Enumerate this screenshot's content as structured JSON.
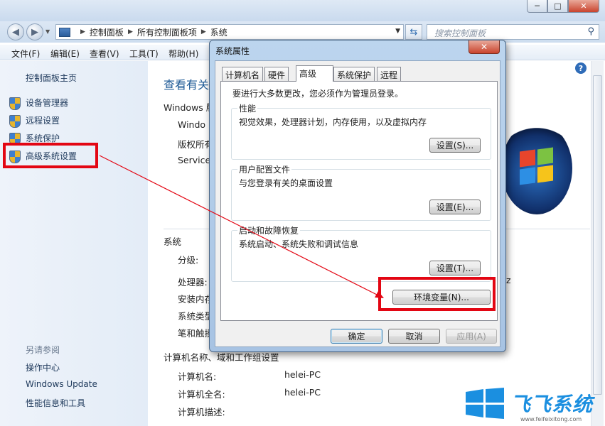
{
  "window": {
    "min_glyph": "─",
    "max_glyph": "□",
    "close_glyph": "✕"
  },
  "address": {
    "crumbs": [
      "控制面板",
      "所有控制面板项",
      "系统"
    ],
    "search_placeholder": "搜索控制面板"
  },
  "menu": [
    "文件(F)",
    "编辑(E)",
    "查看(V)",
    "工具(T)",
    "帮助(H)"
  ],
  "left_pane": {
    "home": "控制面板主页",
    "items": [
      "设备管理器",
      "远程设置",
      "系统保护",
      "高级系统设置"
    ],
    "see_also": "另请参阅",
    "links": [
      "操作中心",
      "Windows Update",
      "性能信息和工具"
    ]
  },
  "main": {
    "title": "查看有关",
    "edition_heading": "Windows 版",
    "edition_lines": [
      "Windo",
      "版权所有",
      "Service"
    ],
    "system_heading": "系统",
    "system_labels": [
      "分级:",
      "处理器:",
      "安装内存",
      "系统类型",
      "笔和触摸"
    ],
    "proc_tail": "z",
    "computer_heading": "计算机名称、域和工作组设置",
    "computer_rows": [
      {
        "label": "计算机名:",
        "value": "helei-PC"
      },
      {
        "label": "计算机全名:",
        "value": "helei-PC"
      },
      {
        "label": "计算机描述:",
        "value": ""
      }
    ]
  },
  "dialog": {
    "title": "系统属性",
    "tabs": [
      "计算机名",
      "硬件",
      "高级",
      "系统保护",
      "远程"
    ],
    "active_tab": "高级",
    "notice": "要进行大多数更改，您必须作为管理员登录。",
    "groups": [
      {
        "title": "性能",
        "desc": "视觉效果，处理器计划，内存使用，以及虚拟内存",
        "button": "设置(S)..."
      },
      {
        "title": "用户配置文件",
        "desc": "与您登录有关的桌面设置",
        "button": "设置(E)..."
      },
      {
        "title": "启动和故障恢复",
        "desc": "系统启动、系统失败和调试信息",
        "button": "设置(T)..."
      }
    ],
    "env_button": "环境变量(N)...",
    "ok": "确定",
    "cancel": "取消",
    "apply": "应用(A)"
  },
  "watermark": {
    "text": "飞飞系统",
    "url": "www.feifeixitong.com"
  },
  "colors": {
    "highlight_red": "#e30613",
    "link_blue": "#1e395b",
    "title_blue": "#1e5a96"
  }
}
